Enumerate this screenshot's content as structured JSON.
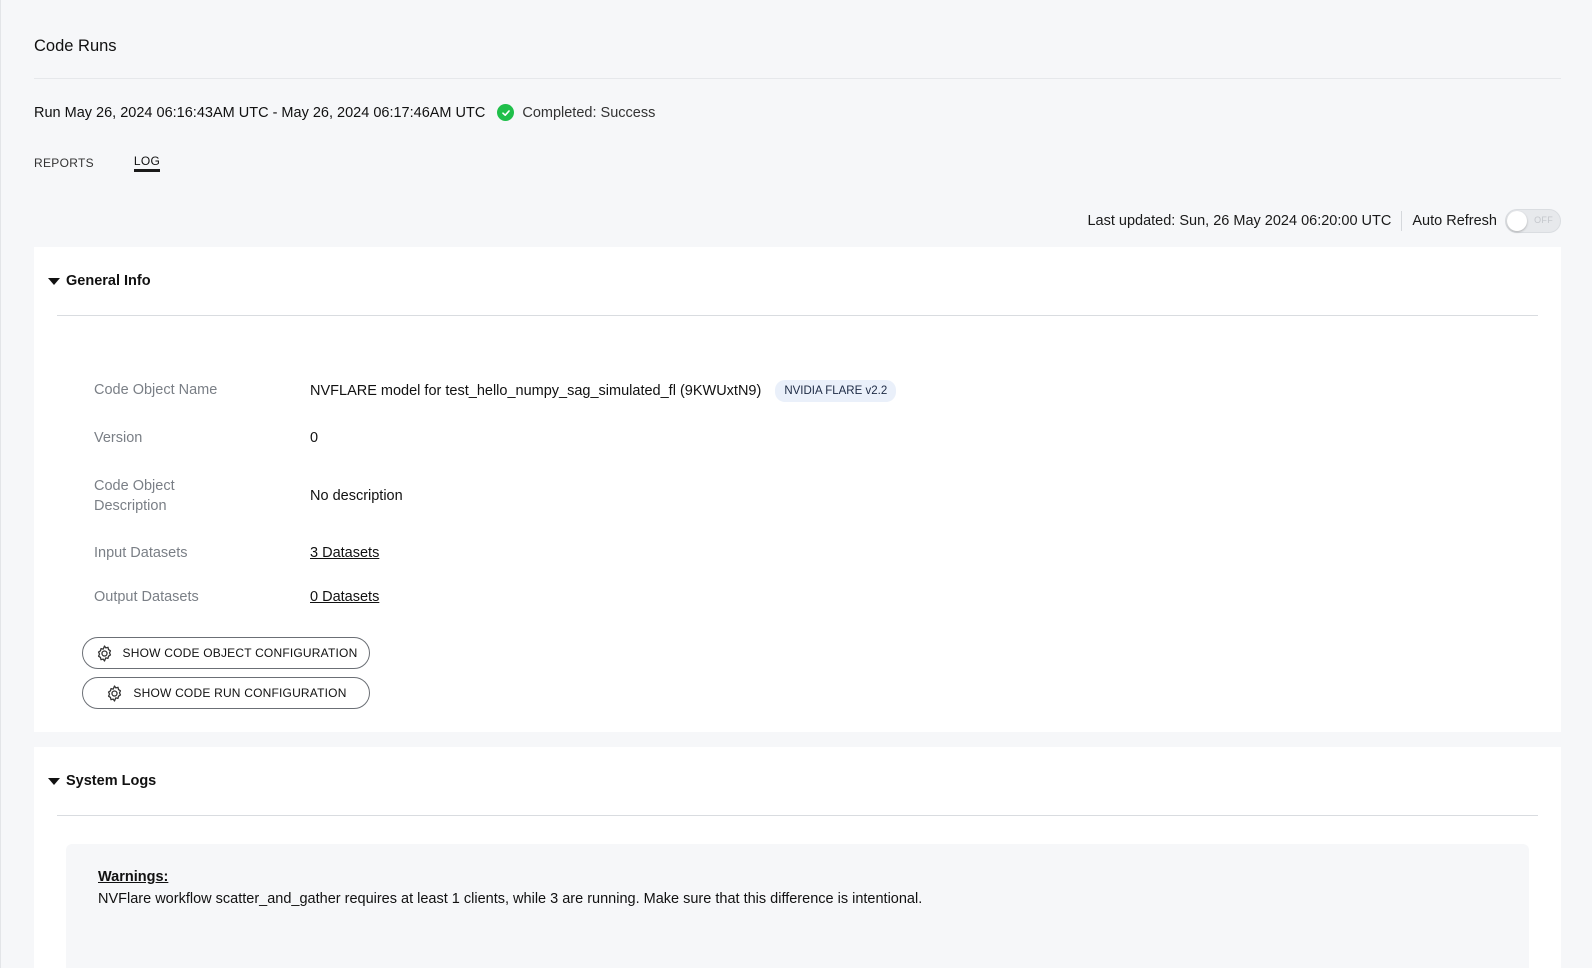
{
  "page": {
    "title": "Code Runs"
  },
  "run": {
    "text": "Run May 26, 2024 06:16:43AM UTC - May 26, 2024 06:17:46AM UTC",
    "status": "Completed: Success",
    "status_color": "#1fbf4a"
  },
  "tabs": [
    {
      "label": "REPORTS",
      "active": false
    },
    {
      "label": "LOG",
      "active": true
    }
  ],
  "refresh": {
    "last_updated": "Last updated: Sun, 26 May 2024 06:20:00 UTC",
    "auto_refresh_label": "Auto Refresh",
    "toggle_state": "OFF"
  },
  "general_info": {
    "title": "General Info",
    "rows": {
      "code_object_name": {
        "label": "Code Object Name",
        "value": "NVFLARE model for test_hello_numpy_sag_simulated_fl (9KWUxtN9)",
        "badge": "NVIDIA FLARE v2.2"
      },
      "version": {
        "label": "Version",
        "value": "0"
      },
      "description": {
        "label": "Code Object Description",
        "value": "No description"
      },
      "input_datasets": {
        "label": "Input Datasets",
        "value": "3 Datasets"
      },
      "output_datasets": {
        "label": "Output Datasets",
        "value": "0 Datasets"
      }
    },
    "buttons": {
      "show_code_object_config": "SHOW CODE OBJECT CONFIGURATION",
      "show_code_run_config": "SHOW CODE RUN CONFIGURATION"
    }
  },
  "system_logs": {
    "title": "System Logs",
    "warnings_title": "Warnings:",
    "warning_text": "NVFlare workflow scatter_and_gather requires at least 1 clients, while 3 are running. Make sure that this difference is intentional."
  },
  "icons": {
    "status": "check-circle-icon",
    "caret": "caret-down-icon",
    "gear": "gear-icon"
  }
}
